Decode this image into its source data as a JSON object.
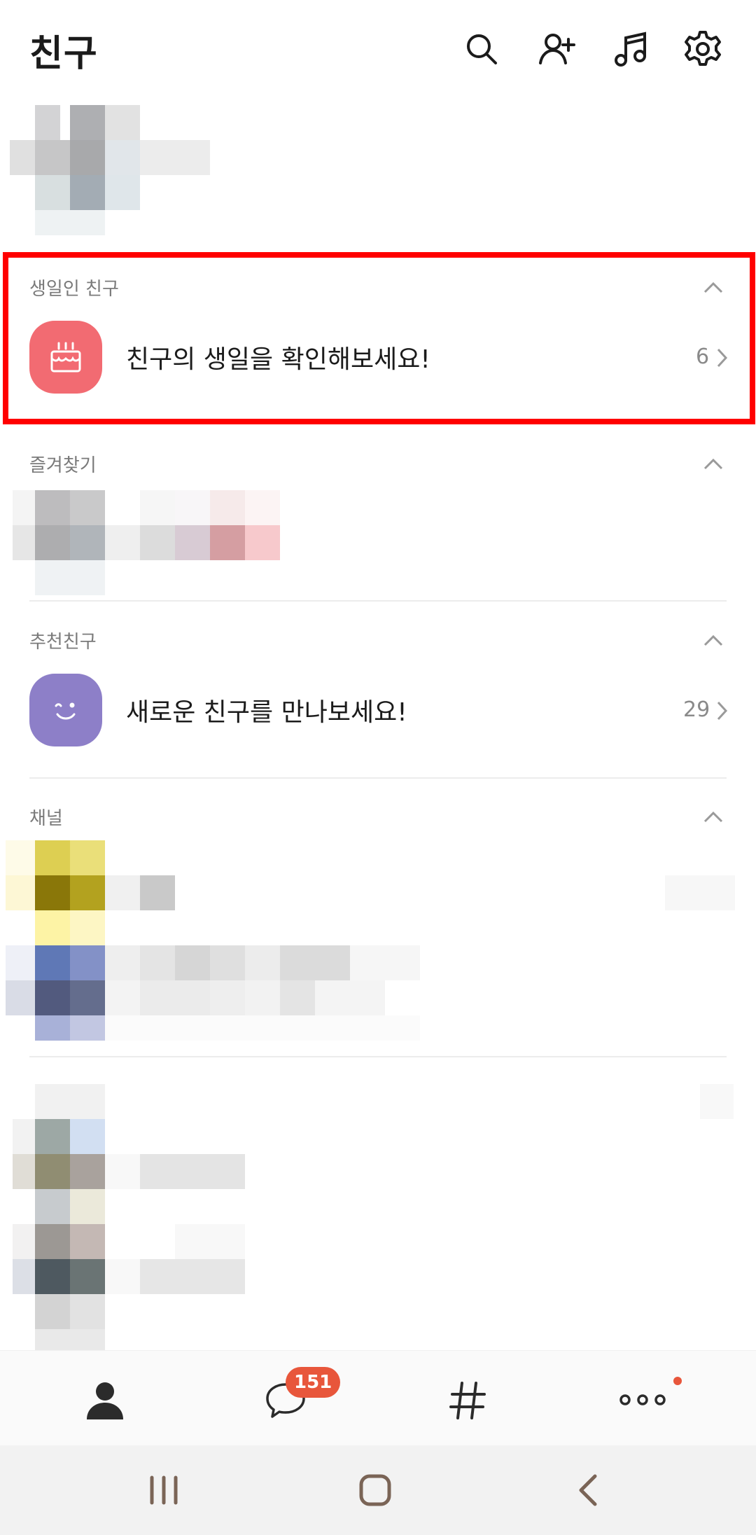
{
  "header": {
    "title": "친구",
    "icons": [
      "search-icon",
      "add-friend-icon",
      "music-icon",
      "settings-icon"
    ]
  },
  "sections": {
    "birthday": {
      "label": "생일인 친구",
      "text": "친구의 생일을 확인해보세요!",
      "count": "6",
      "icon": "cake-icon",
      "icon_color": "#f26b72"
    },
    "favorites": {
      "label": "즐겨찾기"
    },
    "recommended": {
      "label": "추천친구",
      "text": "새로운 친구를 만나보세요!",
      "count": "29",
      "icon": "smile-icon",
      "icon_color": "#8d7fc8"
    },
    "channel": {
      "label": "채널"
    }
  },
  "tabbar": {
    "tabs": [
      "friends-tab",
      "chats-tab",
      "openchat-tab",
      "more-tab"
    ],
    "chat_badge": "151",
    "active_color": "#2b2b2b",
    "badge_color": "#e8563b"
  },
  "navbar": {
    "buttons": [
      "recent-apps-button",
      "home-button",
      "back-button"
    ],
    "icon_color": "#7a6456"
  },
  "highlight_color": "#ff0000"
}
